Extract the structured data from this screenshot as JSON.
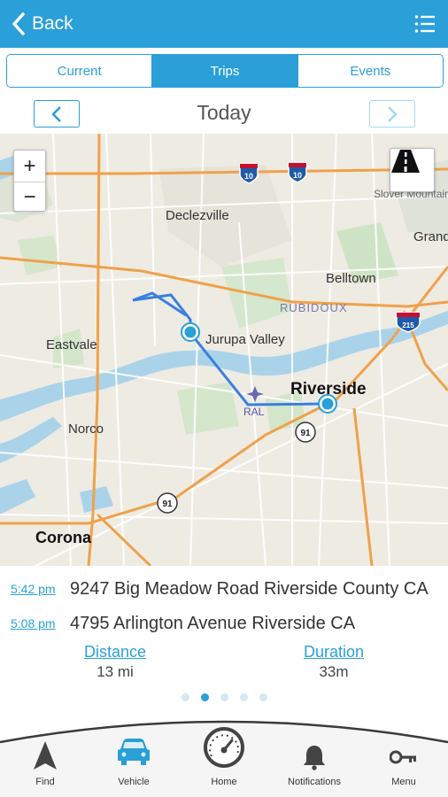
{
  "header": {
    "back_label": "Back",
    "menu_icon": "list-menu-icon"
  },
  "tabs": [
    {
      "label": "Current",
      "active": false
    },
    {
      "label": "Trips",
      "active": true
    },
    {
      "label": "Events",
      "active": false
    }
  ],
  "day_nav": {
    "title": "Today",
    "prev_icon": "chevron-left-icon",
    "next_icon": "chevron-right-icon"
  },
  "map": {
    "zoom_in": "+",
    "zoom_out": "−",
    "places": {
      "declezville": "Declezville",
      "slover_mountain": "Slover Mountain",
      "grand": "Grand",
      "belltown": "Belltown",
      "rubidoux": "RUBIDOUX",
      "eastvale": "Eastvale",
      "jurupa_valley": "Jurupa Valley",
      "riverside": "Riverside",
      "ral": "RAL",
      "norco": "Norco",
      "corona": "Corona"
    },
    "shields": {
      "i10_west": "10",
      "i10_east": "10",
      "i215": "215",
      "sr91_east": "91",
      "sr91_west": "91"
    },
    "road_view_icon": "road-icon"
  },
  "trips": [
    {
      "time": "5:42 pm",
      "address": "9247 Big Meadow Road Riverside County CA"
    },
    {
      "time": "5:08 pm",
      "address": "4795 Arlington Avenue Riverside CA"
    }
  ],
  "stats": {
    "distance_label": "Distance",
    "distance_value": "13 mi",
    "duration_label": "Duration",
    "duration_value": "33m"
  },
  "pager": {
    "count": 5,
    "active_index": 1
  },
  "bottom_nav": [
    {
      "label": "Find",
      "icon": "location-arrow-icon"
    },
    {
      "label": "Vehicle",
      "icon": "car-icon"
    },
    {
      "label": "Home",
      "icon": "speedometer-icon"
    },
    {
      "label": "Notifications",
      "icon": "bell-icon"
    },
    {
      "label": "Menu",
      "icon": "key-icon"
    }
  ],
  "colors": {
    "accent": "#2a9fd8",
    "route": "#3a7fe0",
    "water": "#aad3ea",
    "highway": "#f0a14a"
  }
}
